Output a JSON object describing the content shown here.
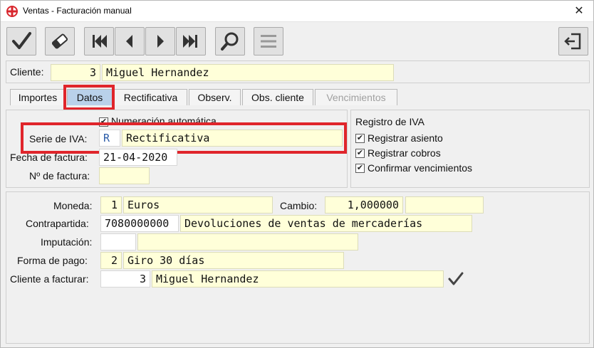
{
  "window": {
    "title": "Ventas - Facturación manual",
    "close_symbol": "✕"
  },
  "toolbar": {
    "buttons": [
      {
        "name": "accept-button",
        "icon": "check-icon"
      },
      {
        "name": "clear-button",
        "icon": "eraser-icon"
      },
      {
        "name": "first-record-button",
        "icon": "first-icon"
      },
      {
        "name": "prev-record-button",
        "icon": "prev-icon"
      },
      {
        "name": "next-record-button",
        "icon": "next-icon"
      },
      {
        "name": "last-record-button",
        "icon": "last-icon"
      },
      {
        "name": "search-button",
        "icon": "search-icon"
      },
      {
        "name": "menu-button",
        "icon": "menu-icon"
      },
      {
        "name": "exit-button",
        "icon": "exit-icon"
      }
    ]
  },
  "client": {
    "label": "Cliente:",
    "code": "3",
    "name": "Miguel Hernandez"
  },
  "tabs": [
    {
      "label": "Importes",
      "state": "normal"
    },
    {
      "label": "Datos",
      "state": "active"
    },
    {
      "label": "Rectificativa",
      "state": "normal"
    },
    {
      "label": "Observ.",
      "state": "normal"
    },
    {
      "label": "Obs. cliente",
      "state": "normal"
    },
    {
      "label": "Vencimientos",
      "state": "disabled"
    }
  ],
  "datos": {
    "numeracion_label": "Numeración automática",
    "numeracion_checked": true,
    "serie_label": "Serie de IVA:",
    "serie_code": "R",
    "serie_name": "Rectificativa",
    "fecha_label": "Fecha de factura:",
    "fecha_value": "21-04-2020",
    "nfactura_label": "Nº de factura:",
    "nfactura_value": ""
  },
  "registro_iva": {
    "title": "Registro de IVA",
    "options": [
      {
        "label": "Registrar asiento",
        "checked": true
      },
      {
        "label": "Registrar cobros",
        "checked": true
      },
      {
        "label": "Confirmar vencimientos",
        "checked": true
      }
    ]
  },
  "details": {
    "moneda_label": "Moneda:",
    "moneda_code": "1",
    "moneda_name": "Euros",
    "cambio_label": "Cambio:",
    "cambio_value": "1,000000",
    "cambio_extra": "",
    "contrapartida_label": "Contrapartida:",
    "contrapartida_code": "7080000000",
    "contrapartida_name": "Devoluciones de ventas de mercaderías",
    "imputacion_label": "Imputación:",
    "imputacion_code": "",
    "imputacion_name": "",
    "forma_pago_label": "Forma de pago:",
    "forma_pago_code": "2",
    "forma_pago_name": "Giro 30 días",
    "cliente_facturar_label": "Cliente a facturar:",
    "cliente_facturar_code": "3",
    "cliente_facturar_name": "Miguel Hernandez"
  },
  "colors": {
    "field_bg": "#ffffd9",
    "active_tab": "#b9d1ea",
    "highlight": "#e0252b"
  }
}
